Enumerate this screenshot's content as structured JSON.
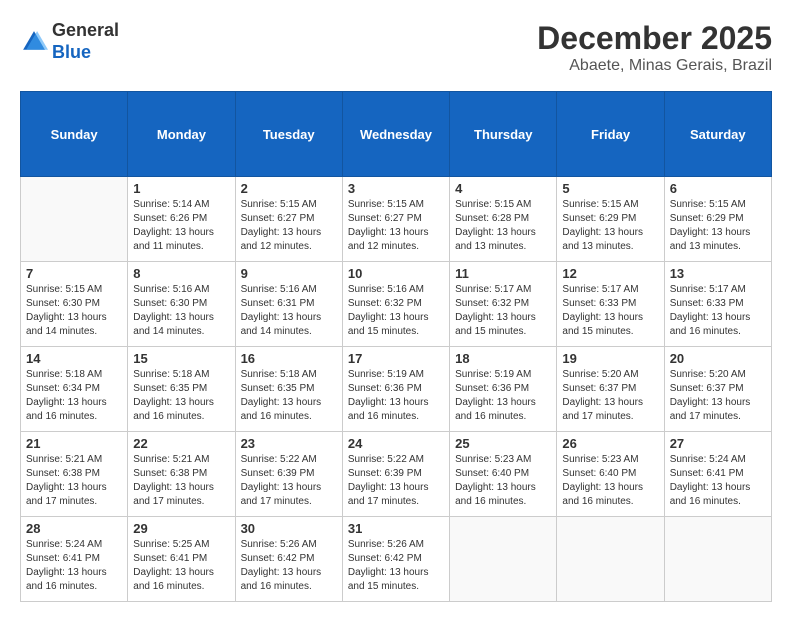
{
  "header": {
    "logo_general": "General",
    "logo_blue": "Blue",
    "month_year": "December 2025",
    "location": "Abaete, Minas Gerais, Brazil"
  },
  "weekdays": [
    "Sunday",
    "Monday",
    "Tuesday",
    "Wednesday",
    "Thursday",
    "Friday",
    "Saturday"
  ],
  "weeks": [
    [
      {
        "day": "",
        "info": ""
      },
      {
        "day": "1",
        "info": "Sunrise: 5:14 AM\nSunset: 6:26 PM\nDaylight: 13 hours\nand 11 minutes."
      },
      {
        "day": "2",
        "info": "Sunrise: 5:15 AM\nSunset: 6:27 PM\nDaylight: 13 hours\nand 12 minutes."
      },
      {
        "day": "3",
        "info": "Sunrise: 5:15 AM\nSunset: 6:27 PM\nDaylight: 13 hours\nand 12 minutes."
      },
      {
        "day": "4",
        "info": "Sunrise: 5:15 AM\nSunset: 6:28 PM\nDaylight: 13 hours\nand 13 minutes."
      },
      {
        "day": "5",
        "info": "Sunrise: 5:15 AM\nSunset: 6:29 PM\nDaylight: 13 hours\nand 13 minutes."
      },
      {
        "day": "6",
        "info": "Sunrise: 5:15 AM\nSunset: 6:29 PM\nDaylight: 13 hours\nand 13 minutes."
      }
    ],
    [
      {
        "day": "7",
        "info": "Sunrise: 5:15 AM\nSunset: 6:30 PM\nDaylight: 13 hours\nand 14 minutes."
      },
      {
        "day": "8",
        "info": "Sunrise: 5:16 AM\nSunset: 6:30 PM\nDaylight: 13 hours\nand 14 minutes."
      },
      {
        "day": "9",
        "info": "Sunrise: 5:16 AM\nSunset: 6:31 PM\nDaylight: 13 hours\nand 14 minutes."
      },
      {
        "day": "10",
        "info": "Sunrise: 5:16 AM\nSunset: 6:32 PM\nDaylight: 13 hours\nand 15 minutes."
      },
      {
        "day": "11",
        "info": "Sunrise: 5:17 AM\nSunset: 6:32 PM\nDaylight: 13 hours\nand 15 minutes."
      },
      {
        "day": "12",
        "info": "Sunrise: 5:17 AM\nSunset: 6:33 PM\nDaylight: 13 hours\nand 15 minutes."
      },
      {
        "day": "13",
        "info": "Sunrise: 5:17 AM\nSunset: 6:33 PM\nDaylight: 13 hours\nand 16 minutes."
      }
    ],
    [
      {
        "day": "14",
        "info": "Sunrise: 5:18 AM\nSunset: 6:34 PM\nDaylight: 13 hours\nand 16 minutes."
      },
      {
        "day": "15",
        "info": "Sunrise: 5:18 AM\nSunset: 6:35 PM\nDaylight: 13 hours\nand 16 minutes."
      },
      {
        "day": "16",
        "info": "Sunrise: 5:18 AM\nSunset: 6:35 PM\nDaylight: 13 hours\nand 16 minutes."
      },
      {
        "day": "17",
        "info": "Sunrise: 5:19 AM\nSunset: 6:36 PM\nDaylight: 13 hours\nand 16 minutes."
      },
      {
        "day": "18",
        "info": "Sunrise: 5:19 AM\nSunset: 6:36 PM\nDaylight: 13 hours\nand 16 minutes."
      },
      {
        "day": "19",
        "info": "Sunrise: 5:20 AM\nSunset: 6:37 PM\nDaylight: 13 hours\nand 17 minutes."
      },
      {
        "day": "20",
        "info": "Sunrise: 5:20 AM\nSunset: 6:37 PM\nDaylight: 13 hours\nand 17 minutes."
      }
    ],
    [
      {
        "day": "21",
        "info": "Sunrise: 5:21 AM\nSunset: 6:38 PM\nDaylight: 13 hours\nand 17 minutes."
      },
      {
        "day": "22",
        "info": "Sunrise: 5:21 AM\nSunset: 6:38 PM\nDaylight: 13 hours\nand 17 minutes."
      },
      {
        "day": "23",
        "info": "Sunrise: 5:22 AM\nSunset: 6:39 PM\nDaylight: 13 hours\nand 17 minutes."
      },
      {
        "day": "24",
        "info": "Sunrise: 5:22 AM\nSunset: 6:39 PM\nDaylight: 13 hours\nand 17 minutes."
      },
      {
        "day": "25",
        "info": "Sunrise: 5:23 AM\nSunset: 6:40 PM\nDaylight: 13 hours\nand 16 minutes."
      },
      {
        "day": "26",
        "info": "Sunrise: 5:23 AM\nSunset: 6:40 PM\nDaylight: 13 hours\nand 16 minutes."
      },
      {
        "day": "27",
        "info": "Sunrise: 5:24 AM\nSunset: 6:41 PM\nDaylight: 13 hours\nand 16 minutes."
      }
    ],
    [
      {
        "day": "28",
        "info": "Sunrise: 5:24 AM\nSunset: 6:41 PM\nDaylight: 13 hours\nand 16 minutes."
      },
      {
        "day": "29",
        "info": "Sunrise: 5:25 AM\nSunset: 6:41 PM\nDaylight: 13 hours\nand 16 minutes."
      },
      {
        "day": "30",
        "info": "Sunrise: 5:26 AM\nSunset: 6:42 PM\nDaylight: 13 hours\nand 16 minutes."
      },
      {
        "day": "31",
        "info": "Sunrise: 5:26 AM\nSunset: 6:42 PM\nDaylight: 13 hours\nand 15 minutes."
      },
      {
        "day": "",
        "info": ""
      },
      {
        "day": "",
        "info": ""
      },
      {
        "day": "",
        "info": ""
      }
    ]
  ]
}
